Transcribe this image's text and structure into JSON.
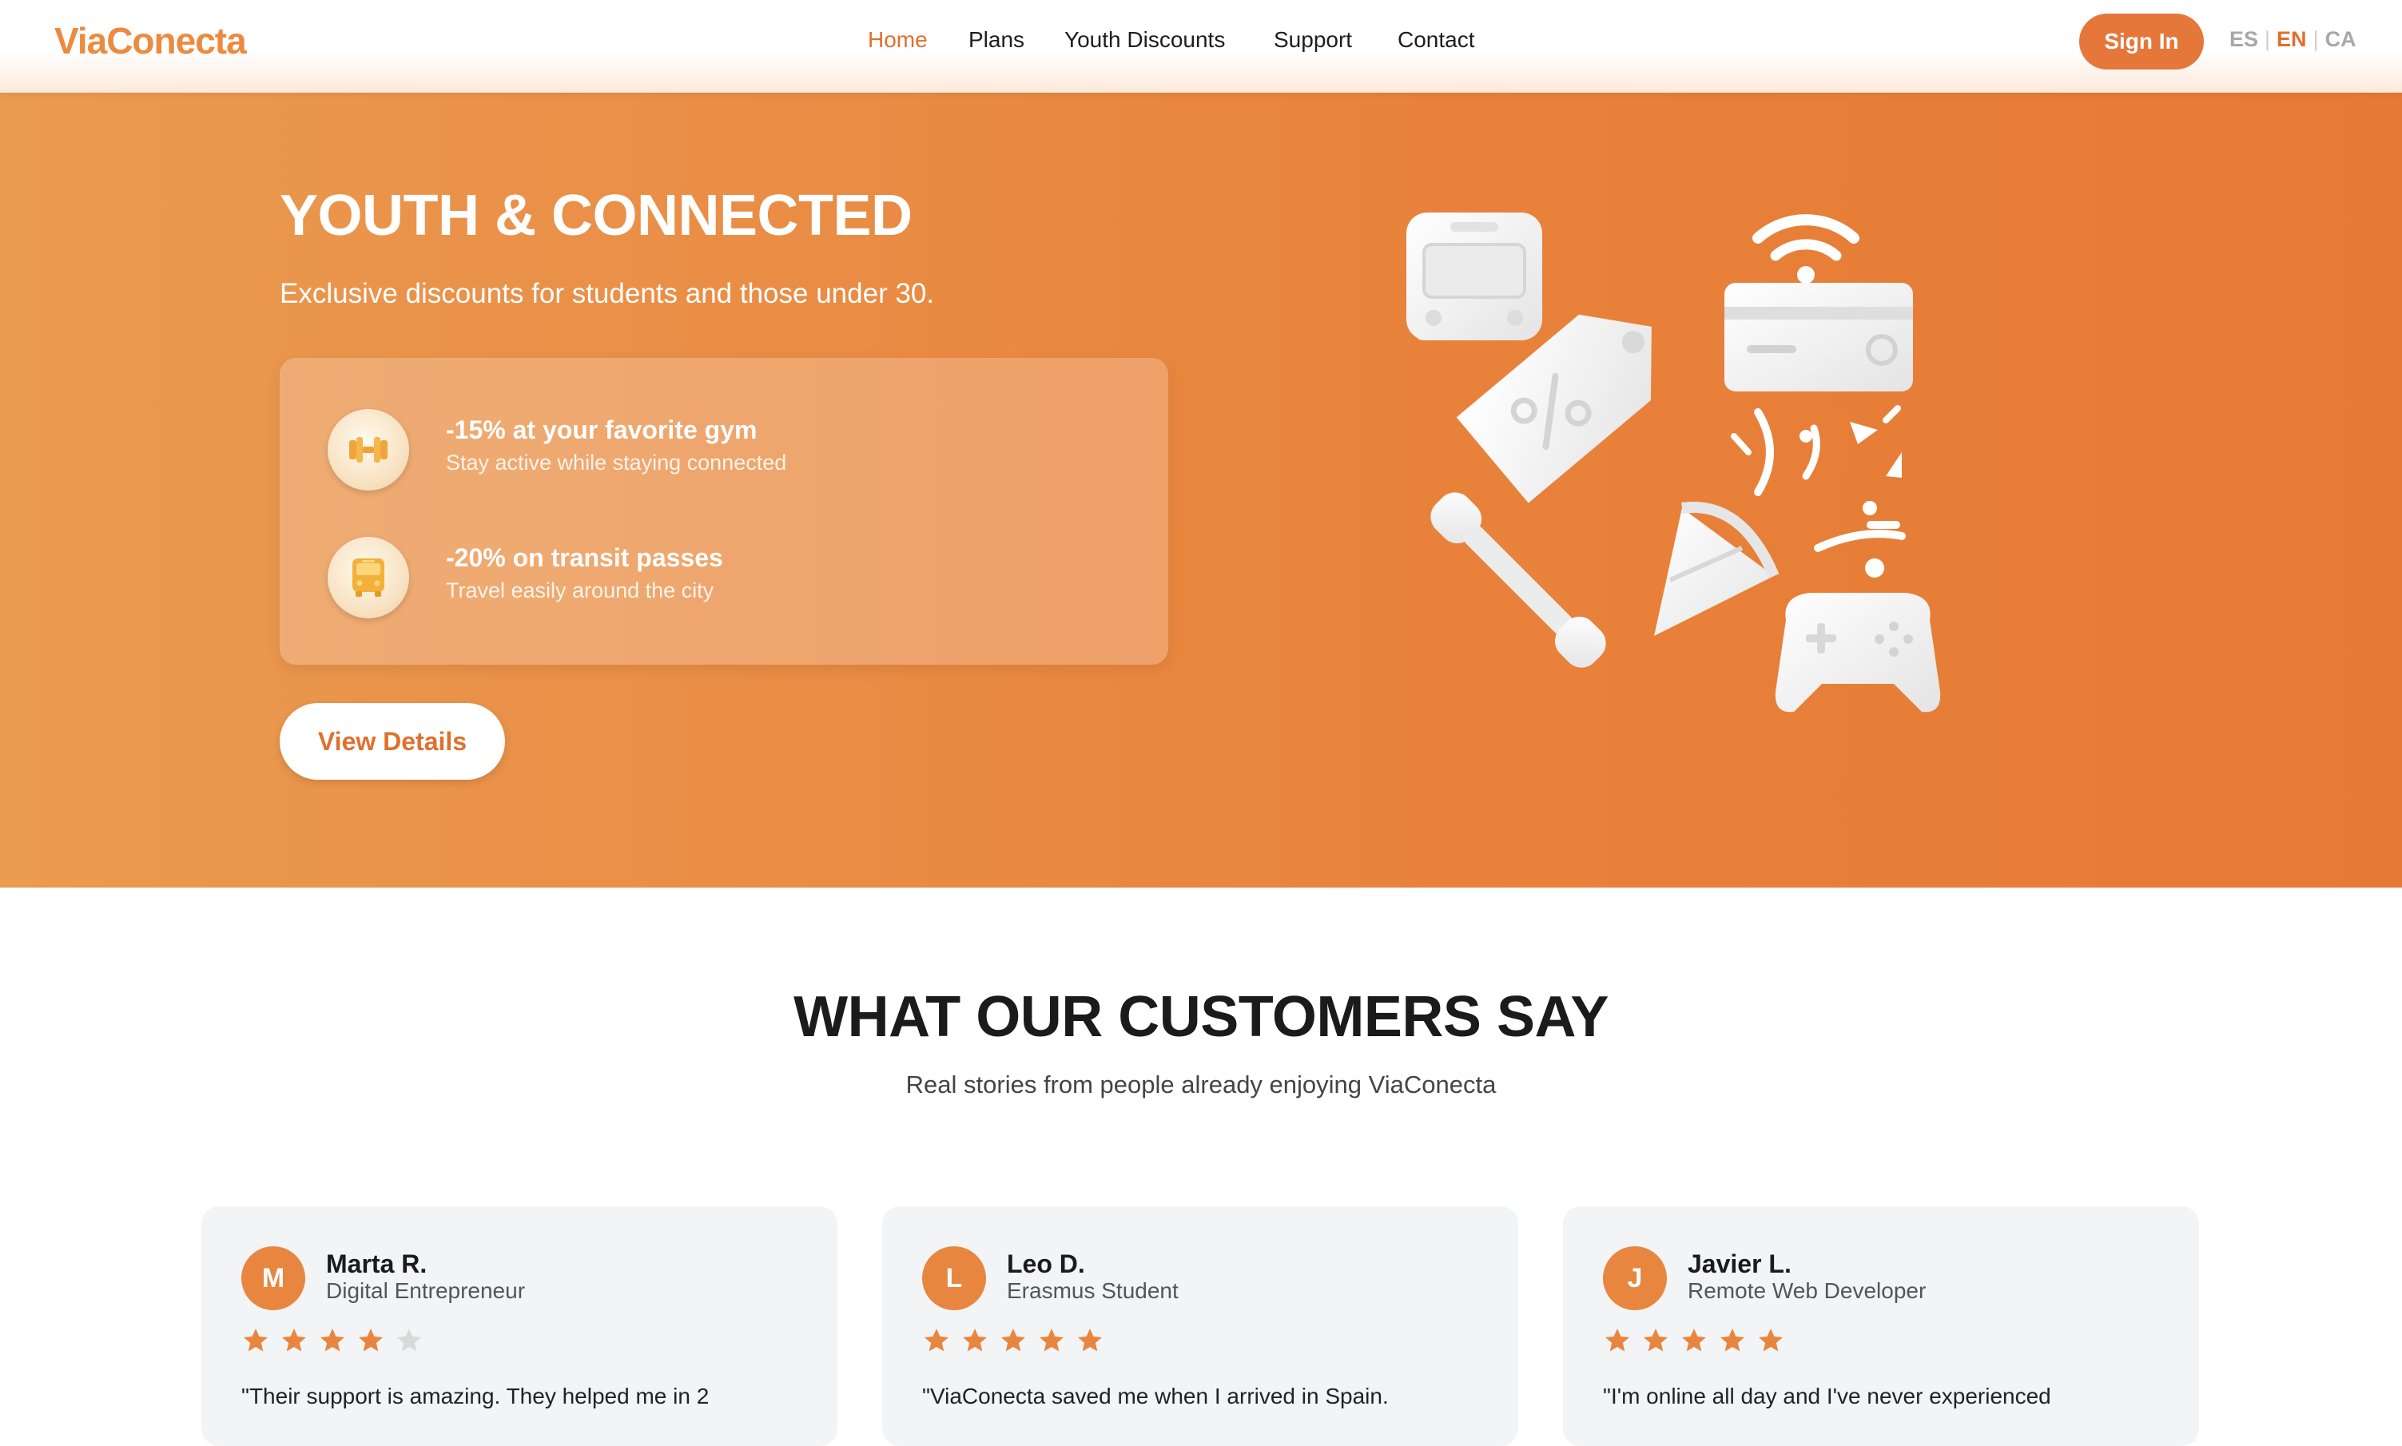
{
  "brand": {
    "logo": "ViaConecta",
    "accent": "#e8823b"
  },
  "nav": {
    "items": [
      {
        "label": "Home",
        "active": true
      },
      {
        "label": "Plans",
        "active": false
      },
      {
        "label": "Youth Discounts",
        "active": false
      },
      {
        "label": "Support",
        "active": false
      },
      {
        "label": "Contact",
        "active": false
      }
    ],
    "signin_label": "Sign In",
    "languages": [
      {
        "code": "ES",
        "selected": false
      },
      {
        "code": "EN",
        "selected": true
      },
      {
        "code": "CA",
        "selected": false
      }
    ],
    "lang_separator": "|"
  },
  "hero": {
    "title": "YOUTH & CONNECTED",
    "subtitle": "Exclusive discounts for students and those under 30.",
    "offers": [
      {
        "icon": "dumbbell-icon",
        "title": "-15% at your favorite gym",
        "desc": "Stay active while staying connected"
      },
      {
        "icon": "bus-icon",
        "title": "-20% on transit passes",
        "desc": "Travel easily around the city"
      }
    ],
    "cta_label": "View Details",
    "illustration_icons": [
      "bus-icon",
      "discount-tag-icon",
      "wifi-card-icon",
      "dumbbell-icon",
      "party-popper-icon",
      "gamepad-icon"
    ]
  },
  "testimonials": {
    "title": "WHAT OUR CUSTOMERS SAY",
    "subtitle": "Real stories from people already enjoying ViaConecta",
    "cards": [
      {
        "initial": "M",
        "name": "Marta R.",
        "role": "Digital Entrepreneur",
        "rating": 4,
        "max_rating": 5,
        "quote": "\"Their support is amazing. They helped me in 2"
      },
      {
        "initial": "L",
        "name": "Leo D.",
        "role": "Erasmus Student",
        "rating": 5,
        "max_rating": 5,
        "quote": "\"ViaConecta saved me when I arrived in Spain."
      },
      {
        "initial": "J",
        "name": "Javier L.",
        "role": "Remote Web Developer",
        "rating": 5,
        "max_rating": 5,
        "quote": "\"I'm online all day and I've never experienced"
      }
    ]
  }
}
